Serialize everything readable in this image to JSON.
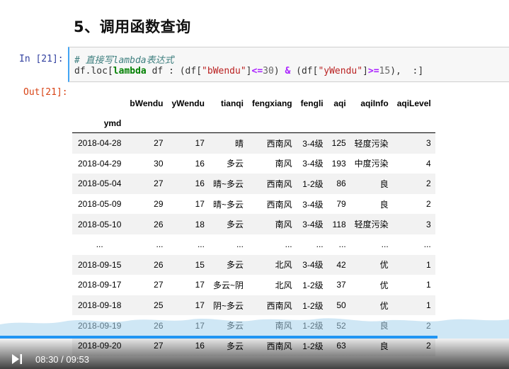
{
  "title": "5、调用函数查询",
  "input_prompt": "In  [21]:",
  "code": {
    "comment": "# 直接写lambda表达式",
    "line2": {
      "p1": "df.loc[",
      "kw": "lambda",
      "p2": " df : (df[",
      "s1": "\"bWendu\"",
      "p3": "]",
      "op1": "<=",
      "n1": "30",
      "p4": ") ",
      "amp": "&",
      "p5": " (df[",
      "s2": "\"yWendu\"",
      "p6": "]",
      "op2": ">=",
      "n2": "15",
      "p7": "),  :]"
    }
  },
  "output_prompt": "Out[21]:",
  "table": {
    "columns": [
      "bWendu",
      "yWendu",
      "tianqi",
      "fengxiang",
      "fengli",
      "aqi",
      "aqiInfo",
      "aqiLevel"
    ],
    "index_name": "ymd",
    "rows": [
      [
        "2018-04-28",
        "27",
        "17",
        "晴",
        "西南风",
        "3-4级",
        "125",
        "轻度污染",
        "3"
      ],
      [
        "2018-04-29",
        "30",
        "16",
        "多云",
        "南风",
        "3-4级",
        "193",
        "中度污染",
        "4"
      ],
      [
        "2018-05-04",
        "27",
        "16",
        "晴~多云",
        "西南风",
        "1-2级",
        "86",
        "良",
        "2"
      ],
      [
        "2018-05-09",
        "29",
        "17",
        "晴~多云",
        "西南风",
        "3-4级",
        "79",
        "良",
        "2"
      ],
      [
        "2018-05-10",
        "26",
        "18",
        "多云",
        "南风",
        "3-4级",
        "118",
        "轻度污染",
        "3"
      ],
      [
        "...",
        "...",
        "...",
        "...",
        "...",
        "...",
        "...",
        "...",
        "..."
      ],
      [
        "2018-09-15",
        "26",
        "15",
        "多云",
        "北风",
        "3-4级",
        "42",
        "优",
        "1"
      ],
      [
        "2018-09-17",
        "27",
        "17",
        "多云~阴",
        "北风",
        "1-2级",
        "37",
        "优",
        "1"
      ],
      [
        "2018-09-18",
        "25",
        "17",
        "阴~多云",
        "西南风",
        "1-2级",
        "50",
        "优",
        "1"
      ],
      [
        "2018-09-19",
        "26",
        "17",
        "多云",
        "南风",
        "1-2级",
        "52",
        "良",
        "2"
      ],
      [
        "2018-09-20",
        "27",
        "16",
        "多云",
        "西南风",
        "1-2级",
        "63",
        "良",
        "2"
      ]
    ]
  },
  "player": {
    "current_time": "08:30",
    "separator": "/",
    "duration": "09:53",
    "progress": 0.859,
    "colors": {
      "progress": "#2196f3",
      "wave": "#a8d4ec"
    }
  }
}
